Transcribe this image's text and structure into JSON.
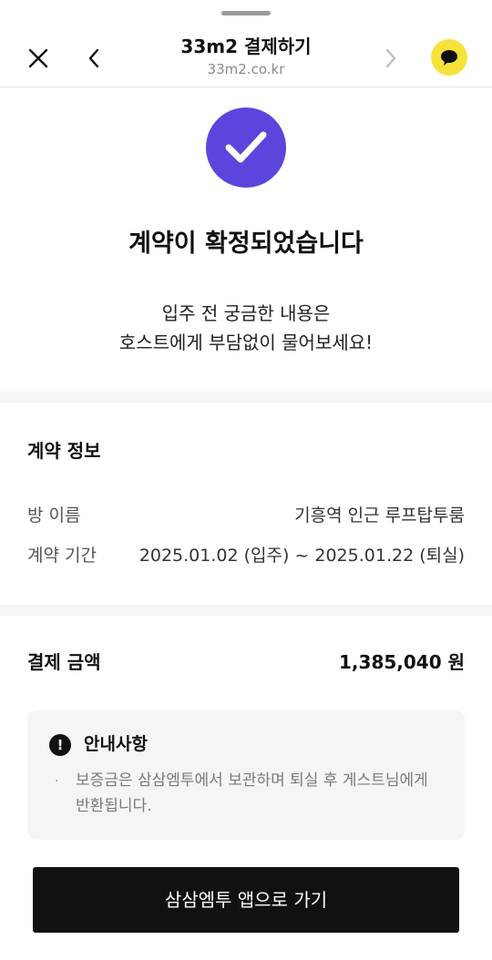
{
  "browser": {
    "title": "33m2 결제하기",
    "url": "33m2.co.kr",
    "close_icon": "close-icon",
    "back_icon": "chevron-left-icon",
    "forward_icon": "chevron-right-icon",
    "chat_icon": "chat-bubble-icon"
  },
  "confirmation": {
    "icon": "check-icon",
    "icon_color": "#5a46dc",
    "title": "계약이 확정되었습니다",
    "subtitle_line1": "입주 전 궁금한 내용은",
    "subtitle_line2": "호스트에게 부담없이 물어보세요!"
  },
  "contract": {
    "title": "계약 정보",
    "room_label": "방 이름",
    "room_value": "기흥역 인근 루프탑투룸",
    "period_label": "계약 기간",
    "period_value": "2025.01.02 (입주) ~ 2025.01.22 (퇴실)"
  },
  "payment": {
    "label": "결제 금액",
    "amount": "1,385,040 원"
  },
  "notice": {
    "icon": "exclamation-icon",
    "icon_glyph": "!",
    "title": "안내사항",
    "bullet": "·",
    "text": "보증금은 삼삼엠투에서 보관하며 퇴실 후 게스트님에게 반환됩니다."
  },
  "cta": {
    "label": "삼삼엠투 앱으로 가기"
  }
}
